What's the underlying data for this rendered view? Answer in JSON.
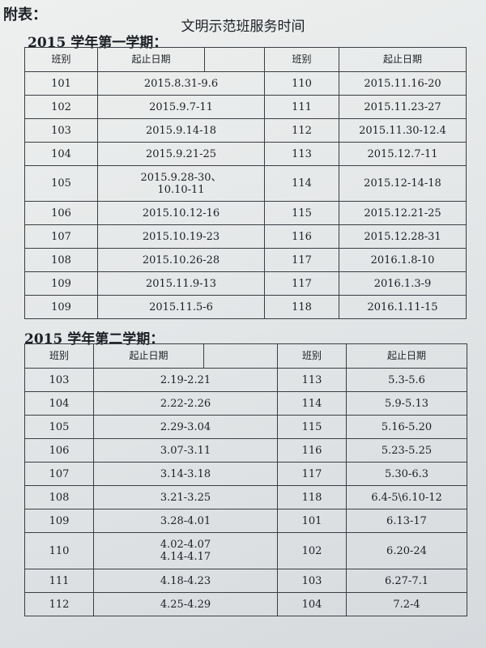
{
  "appendix_label": "附表：",
  "doc_title": "文明示范班服务时间",
  "sections": [
    {
      "title": "2015 学年第一学期：",
      "headers": [
        "班别",
        "起止日期",
        "",
        "班别",
        "起止日期"
      ],
      "rows": [
        [
          "101",
          "2015.8.31-9.6",
          "110",
          "2015.11.16-20"
        ],
        [
          "102",
          "2015.9.7-11",
          "111",
          "2015.11.23-27"
        ],
        [
          "103",
          "2015.9.14-18",
          "112",
          "2015.11.30-12.4"
        ],
        [
          "104",
          "2015.9.21-25",
          "113",
          "2015.12.7-11"
        ],
        [
          "105",
          "2015.9.28-30、\n10.10-11",
          "114",
          "2015.12-14-18"
        ],
        [
          "106",
          "2015.10.12-16",
          "115",
          "2015.12.21-25"
        ],
        [
          "107",
          "2015.10.19-23",
          "116",
          "2015.12.28-31"
        ],
        [
          "108",
          "2015.10.26-28",
          "117",
          "2016.1.8-10"
        ],
        [
          "109",
          "2015.11.9-13",
          "117",
          "2016.1.3-9"
        ],
        [
          "109",
          "2015.11.5-6",
          "118",
          "2016.1.11-15"
        ]
      ]
    },
    {
      "title": "2015 学年第二学期：",
      "headers": [
        "班别",
        "起止日期",
        "",
        "班别",
        "起止日期"
      ],
      "rows": [
        [
          "103",
          "2.19-2.21",
          "113",
          "5.3-5.6"
        ],
        [
          "104",
          "2.22-2.26",
          "114",
          "5.9-5.13"
        ],
        [
          "105",
          "2.29-3.04",
          "115",
          "5.16-5.20"
        ],
        [
          "106",
          "3.07-3.11",
          "116",
          "5.23-5.25"
        ],
        [
          "107",
          "3.14-3.18",
          "117",
          "5.30-6.3"
        ],
        [
          "108",
          "3.21-3.25",
          "118",
          "6.4-5\\6.10-12"
        ],
        [
          "109",
          "3.28-4.01",
          "101",
          "6.13-17"
        ],
        [
          "110",
          "4.02-4.07\n4.14-4.17",
          "102",
          "6.20-24"
        ],
        [
          "111",
          "4.18-4.23",
          "103",
          "6.27-7.1"
        ],
        [
          "112",
          "4.25-4.29",
          "104",
          "7.2-4"
        ]
      ]
    }
  ]
}
